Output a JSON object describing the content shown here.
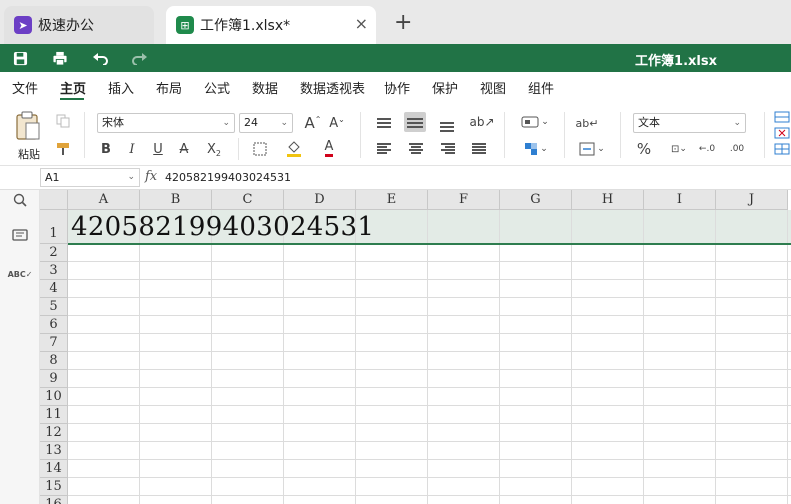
{
  "tabs": {
    "app_label": "极速办公",
    "doc_label": "工作簿1.xlsx*",
    "close_icon": "×",
    "add_icon": "+"
  },
  "titlebar": {
    "title": "工作簿1.xlsx",
    "accent": "#217346"
  },
  "menu": [
    "文件",
    "主页",
    "插入",
    "布局",
    "公式",
    "数据",
    "数据透视表",
    "协作",
    "保护",
    "视图",
    "组件"
  ],
  "menu_active": "主页",
  "ribbon": {
    "paste_label": "粘贴",
    "font_name": "宋体",
    "font_size": "24",
    "number_format": "文本"
  },
  "formula": {
    "name_box": "A1",
    "fx_label": "fx",
    "value": "420582199403024531"
  },
  "grid": {
    "columns": [
      "A",
      "B",
      "C",
      "D",
      "E",
      "F",
      "G",
      "H",
      "I",
      "J"
    ],
    "rows": [
      "1",
      "2",
      "3",
      "4",
      "5",
      "6",
      "7",
      "8",
      "9",
      "10",
      "11",
      "12",
      "13",
      "14",
      "15",
      "16"
    ],
    "A1": "420582199403024531"
  },
  "colors": {
    "selection_row": "#e3ebe6",
    "header_bg": "#e6e6e6",
    "green": "#217346"
  }
}
